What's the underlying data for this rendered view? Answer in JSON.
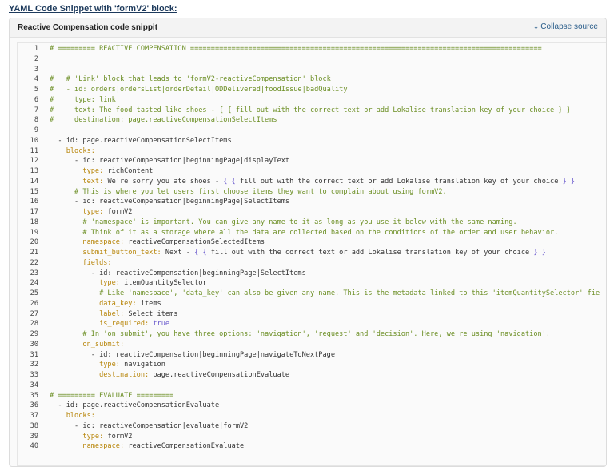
{
  "page": {
    "heading": "YAML Code Snippet with 'formV2' block:"
  },
  "panel": {
    "title": "Reactive Compensation code snippit",
    "collapse_label": "Collapse source",
    "collapse_icon": "chevron-down-icon"
  },
  "code_lines": [
    {
      "n": "1",
      "segs": [
        [
          "c",
          "# ========= REACTIVE COMPENSATION ====================================================================================="
        ]
      ]
    },
    {
      "n": "2",
      "segs": []
    },
    {
      "n": "3",
      "segs": []
    },
    {
      "n": "4",
      "segs": [
        [
          "c",
          "#   # 'Link' block that leads to 'formV2-reactiveCompensation' block"
        ]
      ]
    },
    {
      "n": "5",
      "segs": [
        [
          "c",
          "#   - id: orders|ordersList|orderDetail|ODDelivered|foodIssue|badQuality"
        ]
      ]
    },
    {
      "n": "6",
      "segs": [
        [
          "c",
          "#     type: link"
        ]
      ]
    },
    {
      "n": "7",
      "segs": [
        [
          "c",
          "#     text: The food tasted like shoes - { { fill out with the correct text or add Lokalise translation key of your choice } }"
        ]
      ]
    },
    {
      "n": "8",
      "segs": [
        [
          "c",
          "#     destination: page.reactiveCompensationSelectItems"
        ]
      ]
    },
    {
      "n": "9",
      "segs": []
    },
    {
      "n": "10",
      "segs": [
        [
          "v",
          "  - id: page.reactiveCompensationSelectItems"
        ]
      ]
    },
    {
      "n": "11",
      "segs": [
        [
          "k",
          "    blocks:"
        ]
      ]
    },
    {
      "n": "12",
      "segs": [
        [
          "v",
          "      - id: reactiveCompensation|beginningPage|displayText"
        ]
      ]
    },
    {
      "n": "13",
      "segs": [
        [
          "k",
          "        type: "
        ],
        [
          "v",
          "richContent"
        ]
      ]
    },
    {
      "n": "14",
      "segs": [
        [
          "k",
          "        text: "
        ],
        [
          "v",
          "We're sorry you ate shoes - "
        ],
        [
          "b",
          "{ { "
        ],
        [
          "v",
          "fill out with the correct text or add Lokalise translation key of your choice "
        ],
        [
          "b",
          "} }"
        ]
      ]
    },
    {
      "n": "15",
      "segs": [
        [
          "c",
          "      # This is where you let users first choose items they want to complain about using formV2."
        ]
      ]
    },
    {
      "n": "16",
      "segs": [
        [
          "v",
          "      - id: reactiveCompensation|beginningPage|SelectItems"
        ]
      ]
    },
    {
      "n": "17",
      "segs": [
        [
          "k",
          "        type: "
        ],
        [
          "v",
          "formV2"
        ]
      ]
    },
    {
      "n": "18",
      "segs": [
        [
          "c",
          "        # 'namespace' is important. You can give any name to it as long as you use it below with the same naming."
        ]
      ]
    },
    {
      "n": "19",
      "segs": [
        [
          "c",
          "        # Think of it as a storage where all the data are collected based on the conditions of the order and user behavior."
        ]
      ]
    },
    {
      "n": "20",
      "segs": [
        [
          "k",
          "        namespace: "
        ],
        [
          "v",
          "reactiveCompensationSelectedItems"
        ]
      ]
    },
    {
      "n": "21",
      "segs": [
        [
          "k",
          "        submit_button_text: "
        ],
        [
          "v",
          "Next - "
        ],
        [
          "b",
          "{ { "
        ],
        [
          "v",
          "fill out with the correct text or add Lokalise translation key of your choice "
        ],
        [
          "b",
          "} }"
        ]
      ]
    },
    {
      "n": "22",
      "segs": [
        [
          "k",
          "        fields:"
        ]
      ]
    },
    {
      "n": "23",
      "segs": [
        [
          "v",
          "          - id: reactiveCompensation|beginningPage|SelectItems"
        ]
      ]
    },
    {
      "n": "24",
      "segs": [
        [
          "k",
          "            type: "
        ],
        [
          "v",
          "itemQuantitySelector"
        ]
      ]
    },
    {
      "n": "25",
      "segs": [
        [
          "c",
          "            # Like 'namespace', 'data_key' can also be given any name. This is the metadata linked to this 'itemQuantitySelector' fie"
        ]
      ]
    },
    {
      "n": "26",
      "segs": [
        [
          "k",
          "            data_key: "
        ],
        [
          "v",
          "items"
        ]
      ]
    },
    {
      "n": "27",
      "segs": [
        [
          "k",
          "            label: "
        ],
        [
          "v",
          "Select items"
        ]
      ]
    },
    {
      "n": "28",
      "segs": [
        [
          "k",
          "            is_required: "
        ],
        [
          "b",
          "true"
        ]
      ]
    },
    {
      "n": "29",
      "segs": [
        [
          "c",
          "        # In 'on_submit', you have three options: 'navigation', 'request' and 'decision'. Here, we're using 'navigation'."
        ]
      ]
    },
    {
      "n": "30",
      "segs": [
        [
          "k",
          "        on_submit:"
        ]
      ]
    },
    {
      "n": "31",
      "segs": [
        [
          "v",
          "          - id: reactiveCompensation|beginningPage|navigateToNextPage"
        ]
      ]
    },
    {
      "n": "32",
      "segs": [
        [
          "k",
          "            type: "
        ],
        [
          "v",
          "navigation"
        ]
      ]
    },
    {
      "n": "33",
      "segs": [
        [
          "k",
          "            destination: "
        ],
        [
          "v",
          "page.reactiveCompensationEvaluate"
        ]
      ]
    },
    {
      "n": "34",
      "segs": []
    },
    {
      "n": "35",
      "segs": [
        [
          "c",
          "# ========= EVALUATE ========="
        ]
      ]
    },
    {
      "n": "36",
      "segs": [
        [
          "v",
          "  - id: page.reactiveCompensationEvaluate"
        ]
      ]
    },
    {
      "n": "37",
      "segs": [
        [
          "k",
          "    blocks:"
        ]
      ]
    },
    {
      "n": "38",
      "segs": [
        [
          "v",
          "      - id: reactiveCompensation|evaluate|formV2"
        ]
      ]
    },
    {
      "n": "39",
      "segs": [
        [
          "k",
          "        type: "
        ],
        [
          "v",
          "formV2"
        ]
      ]
    },
    {
      "n": "40",
      "segs": [
        [
          "k",
          "        namespace: "
        ],
        [
          "v",
          "reactiveCompensationEvaluate"
        ]
      ]
    }
  ],
  "colors": {
    "comment": "#6b8e23",
    "key": "#b8860b",
    "brace": "#6a5acd",
    "link": "#2a5d8a"
  }
}
